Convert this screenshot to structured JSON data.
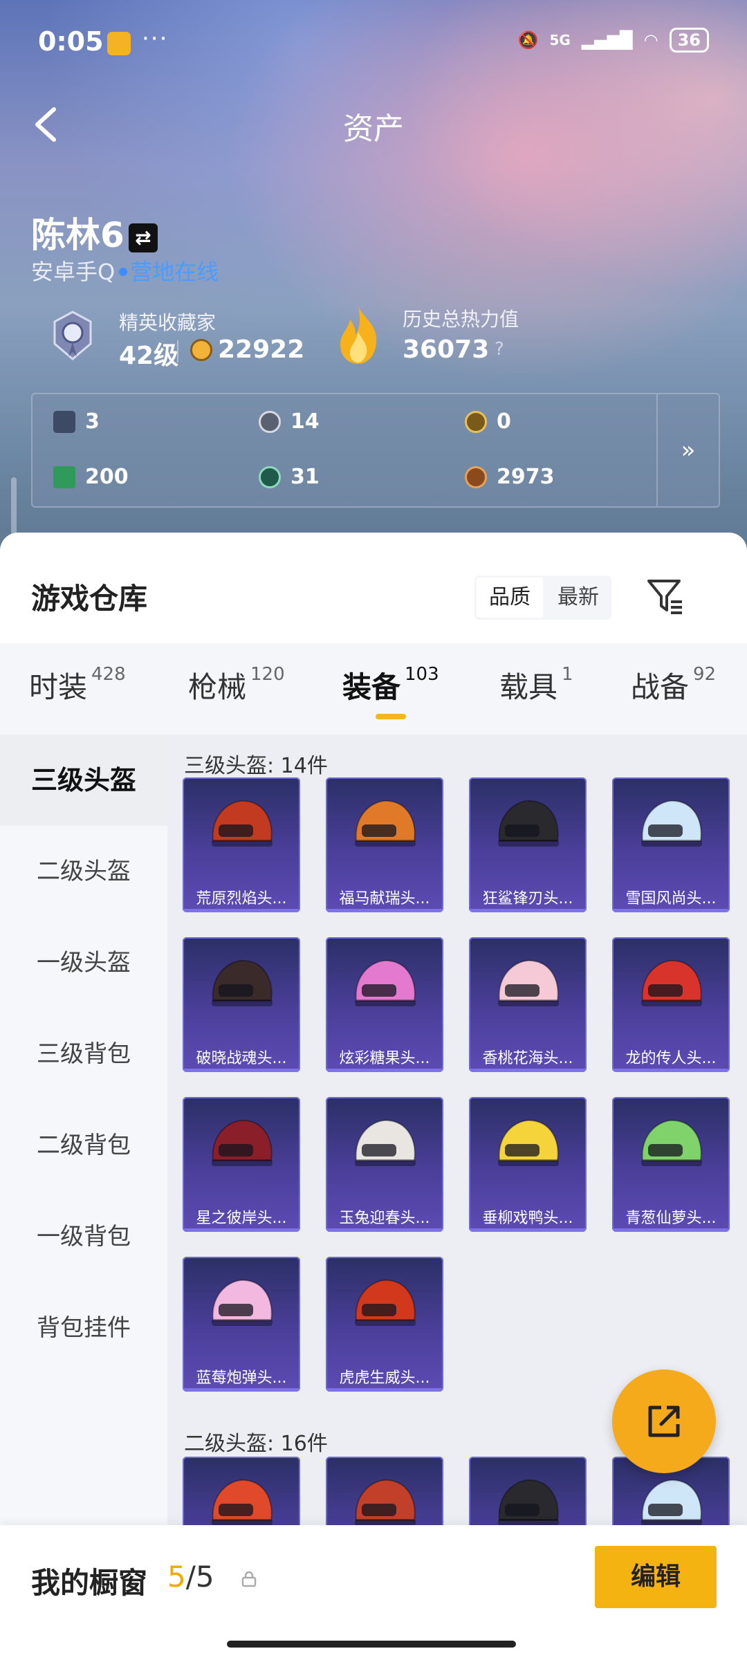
{
  "status_bar": {
    "time": "0:05",
    "battery": "36",
    "network": "5G"
  },
  "header": {
    "title": "资产"
  },
  "profile": {
    "name": "陈林6",
    "platform": "安卓手Q",
    "online_status": "营地在线",
    "collector_title": "精英收藏家",
    "level": "42级",
    "coins": "22922",
    "heat_label": "历史总热力值",
    "heat_value": "36073",
    "help": "?"
  },
  "resources": [
    {
      "icon": "badge-card-icon",
      "value": "3"
    },
    {
      "icon": "silver-coin-icon",
      "value": "14"
    },
    {
      "icon": "gold-coin-icon",
      "value": "0"
    },
    {
      "icon": "green-ticket-icon",
      "value": "200"
    },
    {
      "icon": "gem-icon",
      "value": "31"
    },
    {
      "icon": "bronze-coin-icon",
      "value": "2973"
    }
  ],
  "warehouse": {
    "title": "游戏仓库",
    "sort_options": [
      "品质",
      "最新"
    ],
    "sort_selected": "品质"
  },
  "tabs": [
    {
      "label": "时装",
      "count": "428"
    },
    {
      "label": "枪械",
      "count": "120"
    },
    {
      "label": "装备",
      "count": "103"
    },
    {
      "label": "载具",
      "count": "1"
    },
    {
      "label": "战备",
      "count": "92"
    }
  ],
  "active_tab": "装备",
  "side_items": [
    "三级头盔",
    "二级头盔",
    "一级头盔",
    "三级背包",
    "二级背包",
    "一级背包",
    "背包挂件"
  ],
  "active_side": "三级头盔",
  "sections": [
    {
      "title": "三级头盔: 14件",
      "items": [
        {
          "name": "荒原烈焰头...",
          "color": "#c23a1f"
        },
        {
          "name": "福马献瑞头...",
          "color": "#e07a28"
        },
        {
          "name": "狂鲨锋刃头...",
          "color": "#2a2a2e"
        },
        {
          "name": "雪国风尚头...",
          "color": "#cfe6f8"
        },
        {
          "name": "破晓战魂头...",
          "color": "#3a2a2a"
        },
        {
          "name": "炫彩糖果头...",
          "color": "#e47ad0"
        },
        {
          "name": "香桃花海头...",
          "color": "#f6c9d6"
        },
        {
          "name": "龙的传人头...",
          "color": "#d9342b"
        },
        {
          "name": "星之彼岸头...",
          "color": "#8a1f2a"
        },
        {
          "name": "玉兔迎春头...",
          "color": "#e9e6e2"
        },
        {
          "name": "垂柳戏鸭头...",
          "color": "#f4d43a"
        },
        {
          "name": "青葱仙萝头...",
          "color": "#7fd36a"
        },
        {
          "name": "蓝莓炮弹头...",
          "color": "#f2b8e0"
        },
        {
          "name": "虎虎生威头...",
          "color": "#d2381c"
        }
      ]
    },
    {
      "title": "二级头盔: 16件",
      "items": [
        {
          "name": "",
          "color": "#e04a2a"
        },
        {
          "name": "",
          "color": "#c2402a"
        },
        {
          "name": "",
          "color": "#2a2a2e"
        },
        {
          "name": "",
          "color": "#cfe6f8"
        }
      ]
    }
  ],
  "bottom": {
    "window_label": "我的橱窗",
    "window_used": "5",
    "window_total": "/5",
    "edit_label": "编辑"
  }
}
